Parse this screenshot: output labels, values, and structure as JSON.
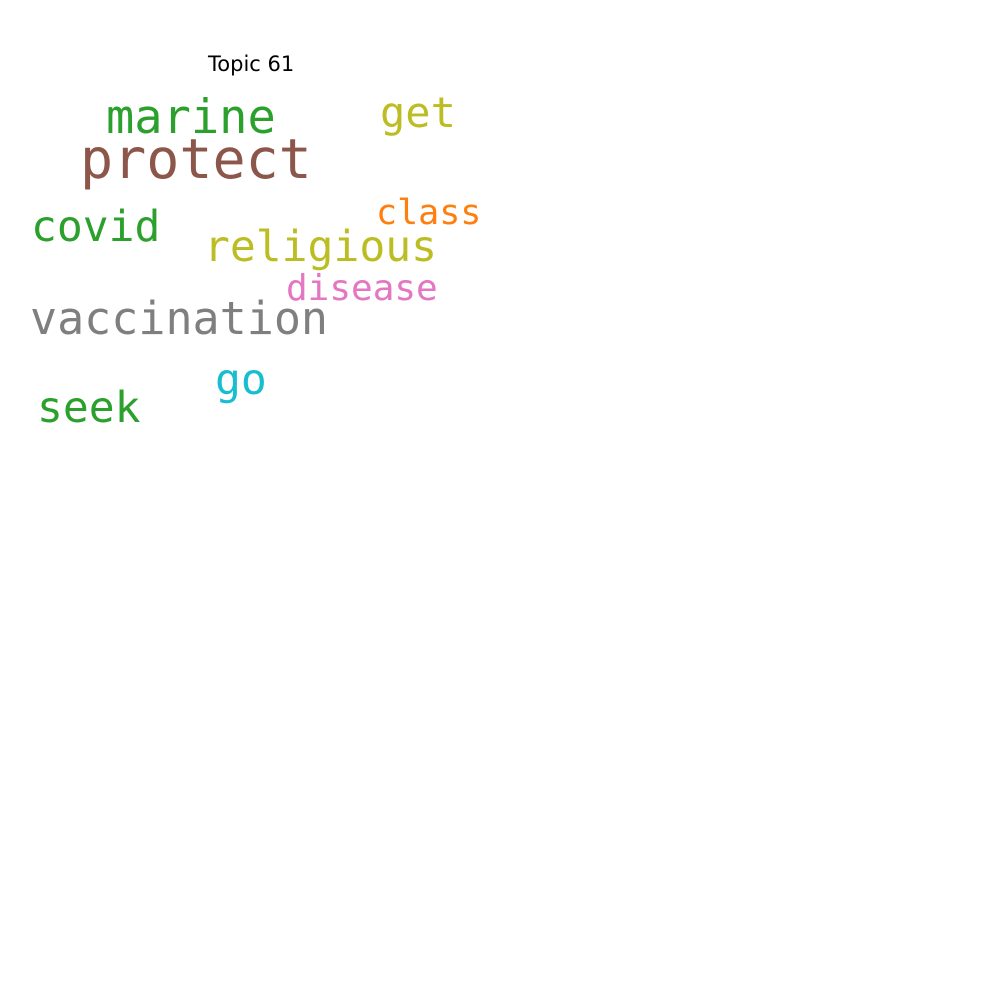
{
  "title": "Topic 61",
  "words": {
    "protect": {
      "text": "protect",
      "color": "#8c564b"
    },
    "marine": {
      "text": "marine",
      "color": "#2ca02c"
    },
    "get": {
      "text": "get",
      "color": "#bcbd22"
    },
    "covid": {
      "text": "covid",
      "color": "#2ca02c"
    },
    "religious": {
      "text": "religious",
      "color": "#bcbd22"
    },
    "class": {
      "text": "class",
      "color": "#ff7f0e"
    },
    "disease": {
      "text": "disease",
      "color": "#e377c2"
    },
    "vaccination": {
      "text": "vaccination",
      "color": "#7f7f7f"
    },
    "go": {
      "text": "go",
      "color": "#17becf"
    },
    "seek": {
      "text": "seek",
      "color": "#2ca02c"
    }
  }
}
